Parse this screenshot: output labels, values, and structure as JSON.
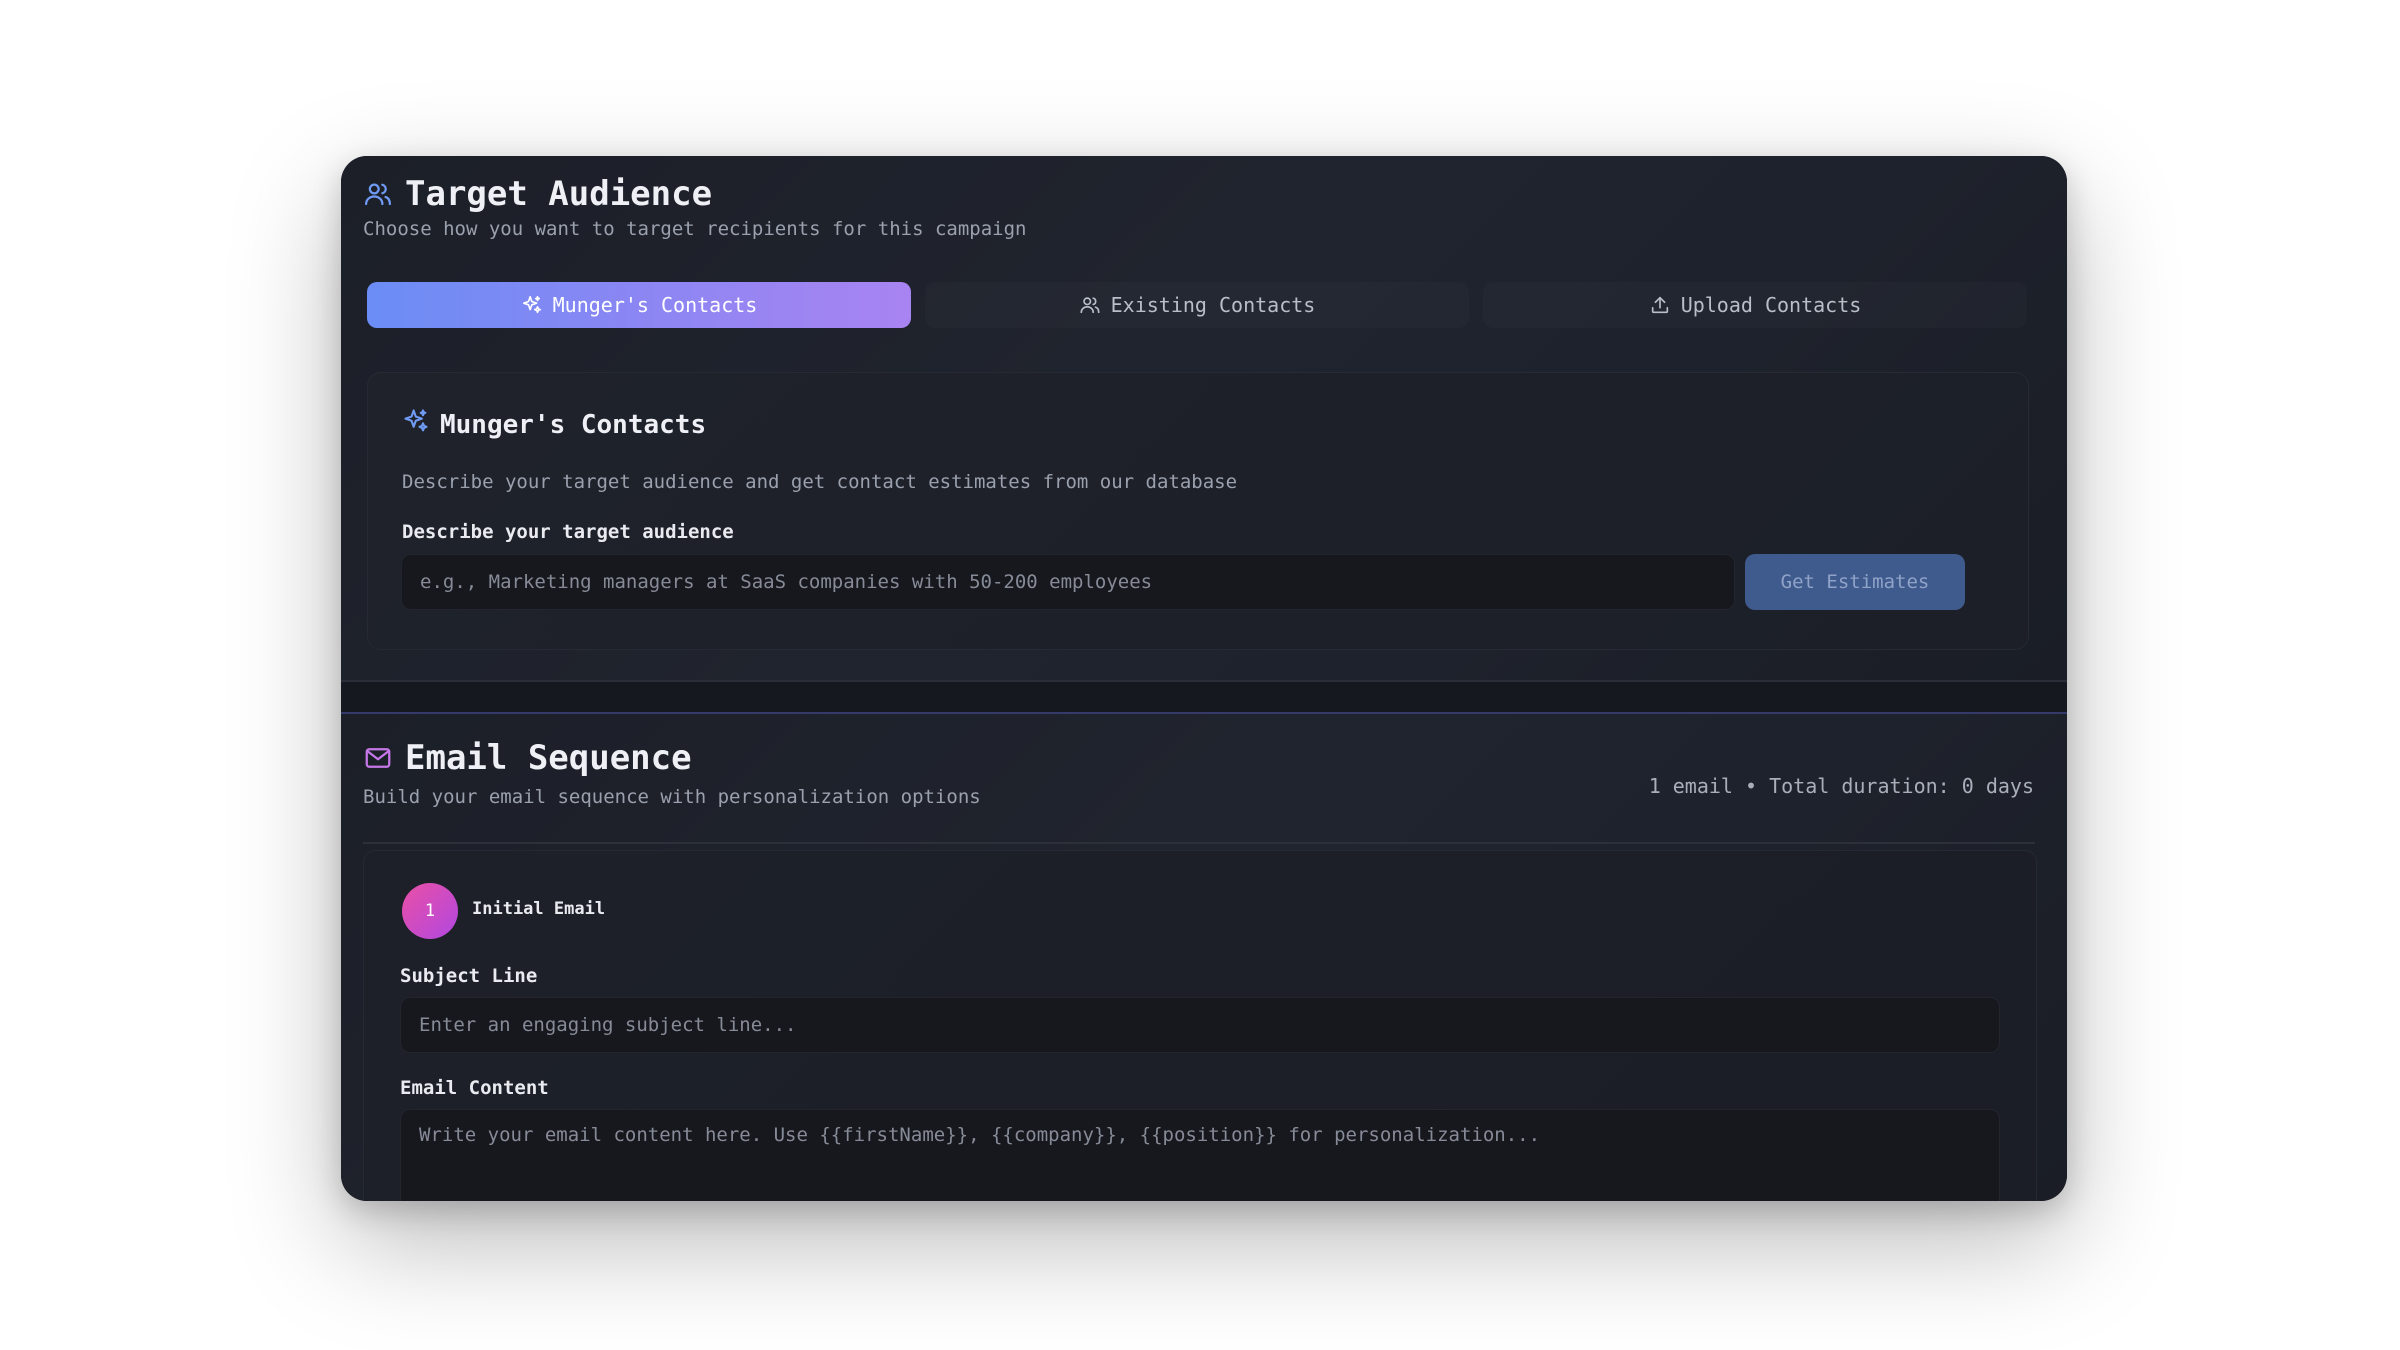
{
  "target_audience": {
    "title": "Target Audience",
    "subtitle": "Choose how you want to target recipients for this campaign",
    "icon": "users-icon",
    "tabs": [
      {
        "label": "Munger's Contacts",
        "icon": "sparkles-icon",
        "active": true
      },
      {
        "label": "Existing Contacts",
        "icon": "users-icon",
        "active": false
      },
      {
        "label": "Upload Contacts",
        "icon": "upload-icon",
        "active": false
      }
    ],
    "panel": {
      "title": "Munger's Contacts",
      "description": "Describe your target audience and get contact estimates from our database",
      "field_label": "Describe your target audience",
      "placeholder": "e.g., Marketing managers at SaaS companies with 50-200 employees",
      "button_label": "Get Estimates"
    }
  },
  "email_sequence": {
    "title": "Email Sequence",
    "subtitle": "Build your email sequence with personalization options",
    "icon": "mail-icon",
    "meta": "1 email • Total duration: 0 days",
    "steps": [
      {
        "number": "1",
        "title": "Initial Email",
        "subject_label": "Subject Line",
        "subject_placeholder": "Enter an engaging subject line...",
        "content_label": "Email Content",
        "content_placeholder": "Write your email content here. Use {{firstName}}, {{company}}, {{position}} for personalization..."
      }
    ]
  },
  "colors": {
    "accent_blue": "#6b8df5",
    "accent_purple": "#a884f2",
    "step_badge": "#d94ab8",
    "background": "#1c1f28"
  }
}
